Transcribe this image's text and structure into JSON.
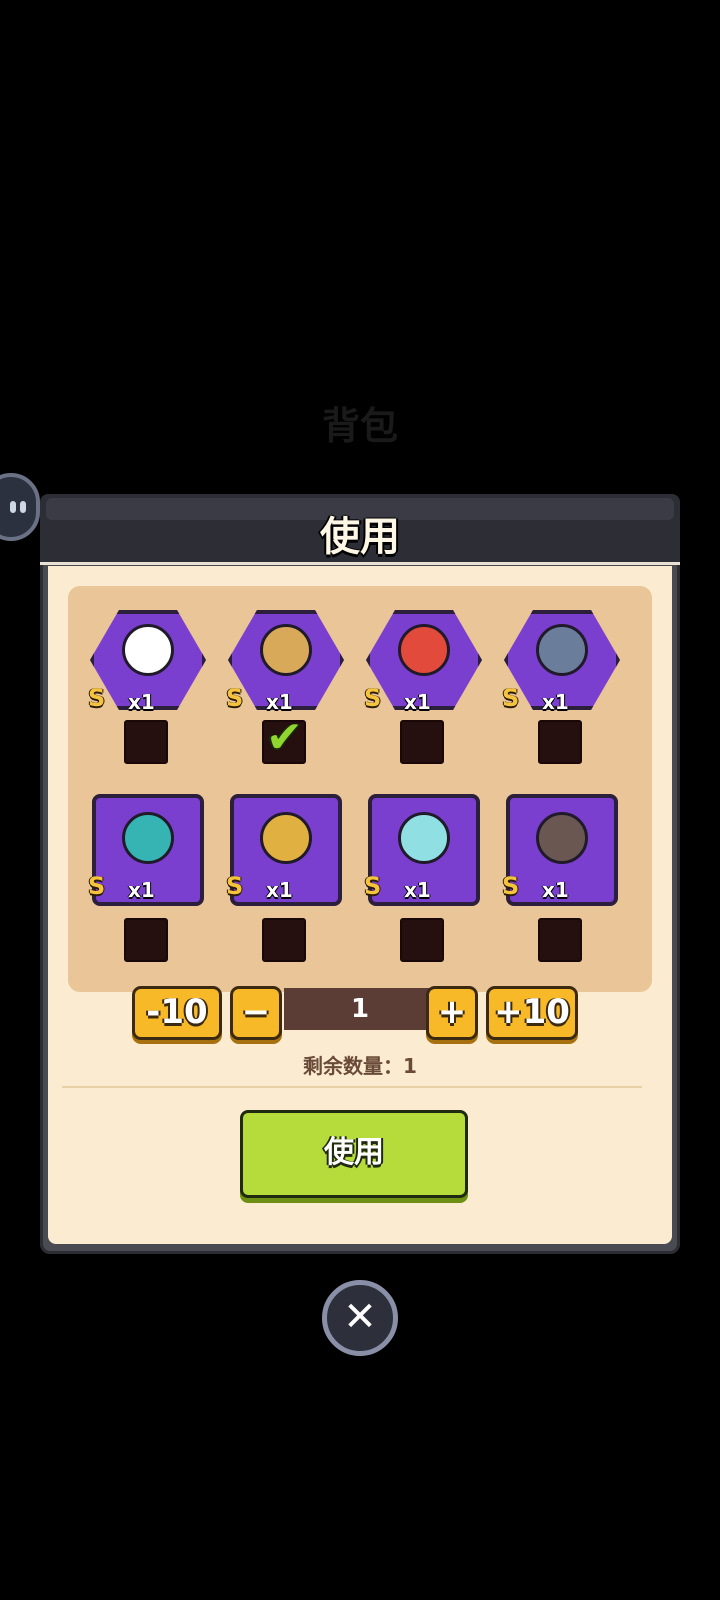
{
  "background_title": "背包",
  "dialog": {
    "title": "使用",
    "cards": [
      {
        "grade": "S",
        "count": "x1",
        "shape": "hex",
        "color": "#ffffff",
        "checked": false
      },
      {
        "grade": "S",
        "count": "x1",
        "shape": "hex",
        "color": "#d9a95a",
        "checked": true
      },
      {
        "grade": "S",
        "count": "x1",
        "shape": "hex",
        "color": "#e24b3c",
        "checked": false
      },
      {
        "grade": "S",
        "count": "x1",
        "shape": "hex",
        "color": "#6a7e9b",
        "checked": false
      },
      {
        "grade": "S",
        "count": "x1",
        "shape": "square",
        "color": "#36b3b3",
        "checked": false
      },
      {
        "grade": "S",
        "count": "x1",
        "shape": "square",
        "color": "#e0b040",
        "checked": false
      },
      {
        "grade": "S",
        "count": "x1",
        "shape": "square",
        "color": "#8fdfe3",
        "checked": false
      },
      {
        "grade": "S",
        "count": "x1",
        "shape": "square",
        "color": "#6a5752",
        "checked": false
      }
    ],
    "quantity": {
      "minus10_label": "-10",
      "minus_label": "−",
      "value": "1",
      "plus_label": "+",
      "plus10_label": "+10"
    },
    "remaining_text": "剩余数量：1",
    "use_button_label": "使用"
  },
  "close_icon": "close-icon",
  "colors": {
    "accent_yellow": "#f7b928",
    "accent_green": "#b6dc3c",
    "card_purple": "#7b3fcf",
    "panel_bg": "#fbecd1"
  }
}
